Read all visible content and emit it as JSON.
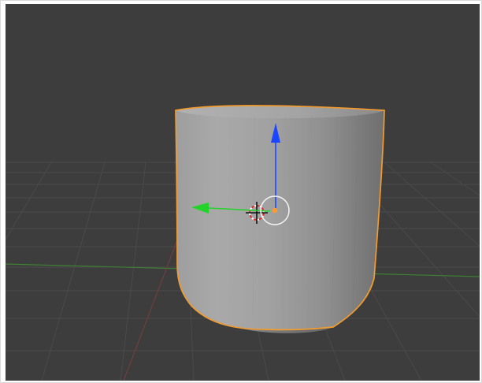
{
  "viewport": {
    "background_color": "#3d3d3d",
    "grid_color": "#4a4a4a",
    "x_axis_line_color": "#3f7f35",
    "y_axis_line_color": "#7a3d3d",
    "selection_outline_color": "#f39c2d",
    "object_fill_light": "#a7a7a7",
    "object_fill_dark": "#777777"
  },
  "object": {
    "shape": "cylinder",
    "selected": true
  },
  "gizmo": {
    "mode": "translate",
    "x_axis_color": "#24d32a",
    "z_axis_color": "#1b46ff",
    "pivot_color": "#ff9b2f",
    "ring_color": "#f4f4f4"
  },
  "cursor_3d": {
    "visible": true,
    "ring_color_a": "#d92d2d",
    "ring_color_b": "#ffffff",
    "cross_color": "#111111"
  },
  "icons": {
    "object": "cylinder-mesh-icon",
    "gizmo": "translate-gizmo-icon",
    "cursor": "3d-cursor-icon"
  }
}
